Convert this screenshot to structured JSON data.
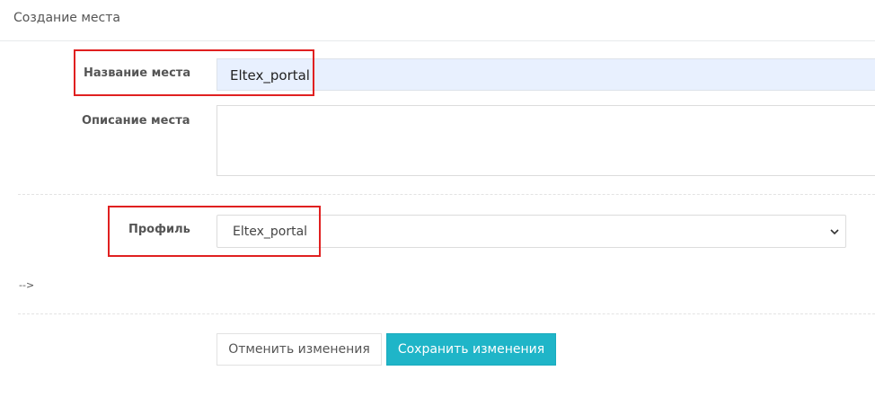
{
  "header": {
    "title": "Создание места"
  },
  "form": {
    "name_label": "Название места",
    "name_value": "Eltex_portal",
    "description_label": "Описание места",
    "description_value": "",
    "profile_label": "Профиль",
    "profile_selected": "Eltex_portal"
  },
  "misc": {
    "arrow_text": "-->"
  },
  "buttons": {
    "cancel_label": "Отменить изменения",
    "save_label": "Сохранить изменения"
  },
  "colors": {
    "accent": "#1fb5c8",
    "highlight": "#e02020",
    "autofill_bg": "#e8f0fe"
  },
  "icons": {
    "select_arrow": "chevron-down-icon"
  }
}
